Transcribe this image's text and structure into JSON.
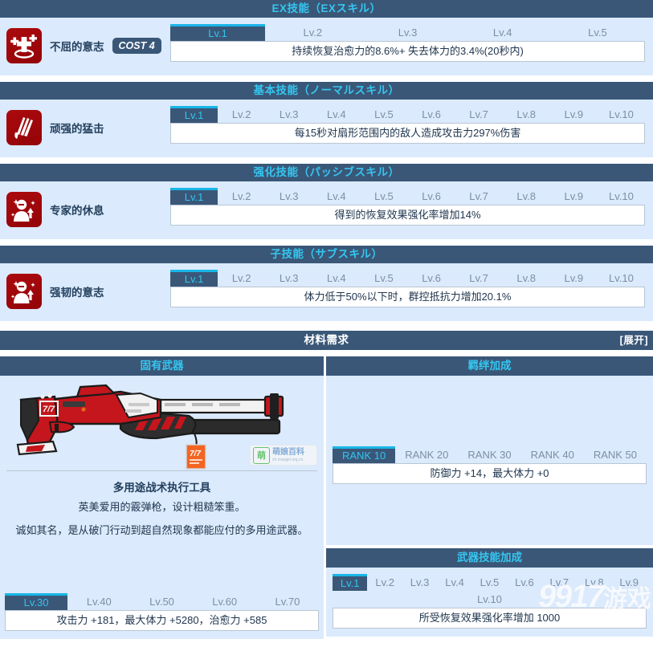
{
  "sections": {
    "ex": {
      "header": "EX技能（EXスキル）",
      "skill_name": "不屈的意志",
      "cost": "COST 4",
      "icon": "heal-cross-icon",
      "levels": [
        "Lv.1",
        "Lv.2",
        "Lv.3",
        "Lv.4",
        "Lv.5"
      ],
      "selected_level": 0,
      "description": "持续恢复治愈力的8.6%+ 失去体力的3.4%(20秒内)"
    },
    "normal": {
      "header": "基本技能（ノーマルスキル）",
      "skill_name": "顽强的猛击",
      "icon": "claw-slash-icon",
      "levels": [
        "Lv.1",
        "Lv.2",
        "Lv.3",
        "Lv.4",
        "Lv.5",
        "Lv.6",
        "Lv.7",
        "Lv.8",
        "Lv.9",
        "Lv.10"
      ],
      "selected_level": 0,
      "description": "每15秒对扇形范围内的敌人造成攻击力297%伤害"
    },
    "passive": {
      "header": "强化技能（パッシブスキル）",
      "skill_name": "专家的休息",
      "icon": "character-buff-icon",
      "levels": [
        "Lv.1",
        "Lv.2",
        "Lv.3",
        "Lv.4",
        "Lv.5",
        "Lv.6",
        "Lv.7",
        "Lv.8",
        "Lv.9",
        "Lv.10"
      ],
      "selected_level": 0,
      "description": "得到的恢复效果强化率增加14%"
    },
    "sub": {
      "header": "子技能（サブスキル）",
      "skill_name": "强韧的意志",
      "icon": "character-buff-icon",
      "levels": [
        "Lv.1",
        "Lv.2",
        "Lv.3",
        "Lv.4",
        "Lv.5",
        "Lv.6",
        "Lv.7",
        "Lv.8",
        "Lv.9",
        "Lv.10"
      ],
      "selected_level": 0,
      "description": "体力低于50%以下时，群控抵抗力增加20.1%"
    }
  },
  "materials": {
    "title": "材料需求",
    "expand": "[展开]"
  },
  "weapon": {
    "column_title": "固有武器",
    "image_alt": "red-white-shotgun",
    "name": "多用途战术执行工具",
    "desc_line1": "英美爱用的霰弹枪，设计粗糙笨重。",
    "desc_line2": "诚如其名，是从破门行动到超自然现象都能应付的多用途武器。",
    "levels": [
      "Lv.30",
      "Lv.40",
      "Lv.50",
      "Lv.60",
      "Lv.70"
    ],
    "selected_level": 0,
    "stats": "攻击力 +181，最大体力 +5280，治愈力 +585"
  },
  "bond": {
    "column_title": "羁绊加成",
    "ranks": [
      "RANK 10",
      "RANK 20",
      "RANK 30",
      "RANK 40",
      "RANK 50"
    ],
    "selected_rank": 0,
    "stats": "防御力 +14，最大体力 +0"
  },
  "weapon_skill": {
    "header": "武器技能加成",
    "levels": [
      "Lv.1",
      "Lv.2",
      "Lv.3",
      "Lv.4",
      "Lv.5",
      "Lv.6",
      "Lv.7",
      "Lv.8",
      "Lv.9"
    ],
    "levels_row2": [
      "Lv.10"
    ],
    "selected_level": 0,
    "description": "所受恢复效果强化率增加 1000"
  },
  "watermarks": {
    "moegirl_logo": "萌",
    "moegirl_name": "萌娘百科",
    "moegirl_url": "zh.moegirl.org.cn",
    "site": "9917",
    "site_cn": "游戏"
  },
  "colors": {
    "bar": "#3a5778",
    "accent": "#35c6f0",
    "body_bg": "#dbeafc",
    "icon_red": "#a3060a",
    "tab_text": "#7d8fa4"
  }
}
